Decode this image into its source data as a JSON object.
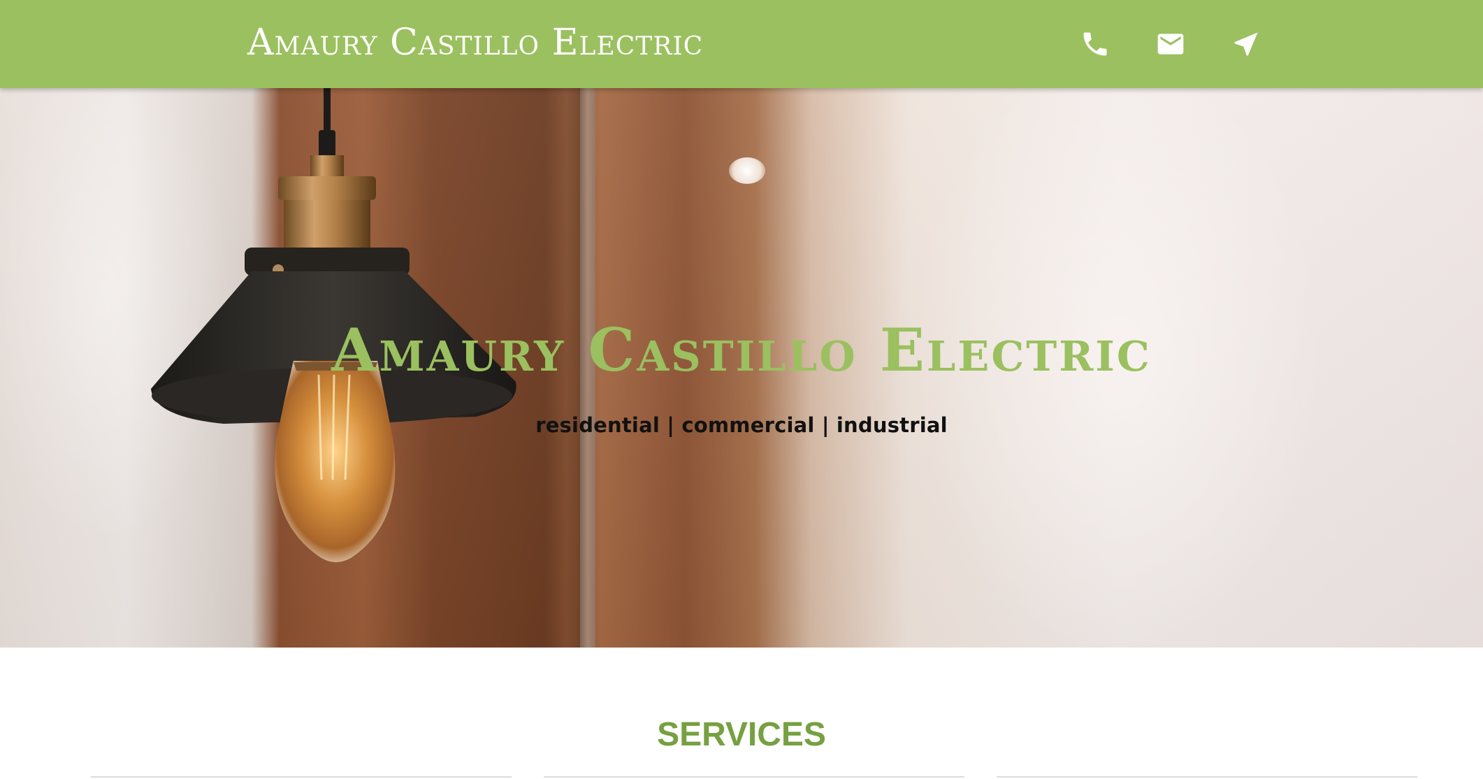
{
  "colors": {
    "accent": "#9bc05f",
    "section_title": "#76a041",
    "hero_subtitle": "#111111"
  },
  "navbar": {
    "brand": "Amaury Castillo Electric",
    "icons": [
      {
        "name": "phone-icon"
      },
      {
        "name": "email-icon"
      },
      {
        "name": "location-arrow-icon"
      }
    ]
  },
  "hero": {
    "title": "Amaury Castillo Electric",
    "subtitle": "residential | commercial | industrial"
  },
  "services": {
    "title": "SERVICES",
    "cards": [
      {},
      {},
      {}
    ]
  }
}
